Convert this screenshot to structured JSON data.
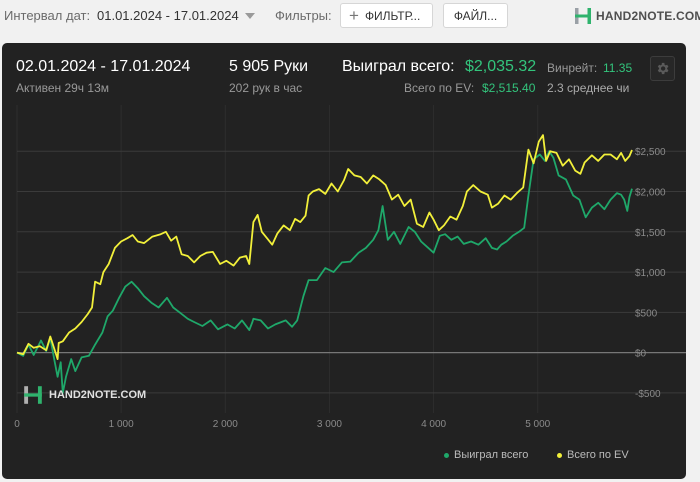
{
  "toolbar": {
    "date_label": "Интервал дат:",
    "date_value": "01.01.2024 - 17.01.2024",
    "filters_label": "Фильтры:",
    "filters_button": "ФИЛЬТР...",
    "files_button": "ФАЙЛ...",
    "logo_text": "HAND2NOTE.COM"
  },
  "stats": {
    "date_range": "02.01.2024 - 17.01.2024",
    "active": "Активен 29ч 13м",
    "hands": "5 905 Руки",
    "hands_per_hour": "202 рук в час",
    "won_total_label": "Выиграл всего:",
    "won_total_value": "$2,035.32",
    "ev_label": "Всего по EV:",
    "ev_value": "$2,515.40",
    "winrate_label": "Винрейт:",
    "winrate_value": "11.35",
    "avg_text": "2.3 среднее чи"
  },
  "watermark": "HAND2NOTE.COM",
  "colors": {
    "won": "#1fa86a",
    "ev": "#f2f03a",
    "background": "#222222",
    "accent": "#33c47c"
  },
  "chart_data": {
    "type": "line",
    "title": "",
    "xlabel": "",
    "ylabel": "",
    "xlim": [
      0,
      5905
    ],
    "ylim": [
      -700,
      2950
    ],
    "x_ticks": [
      0,
      1000,
      2000,
      3000,
      4000,
      5000
    ],
    "x_tick_labels": [
      "0",
      "1 000",
      "2 000",
      "3 000",
      "4 000",
      "5 000"
    ],
    "y_ticks": [
      -500,
      0,
      500,
      1000,
      1500,
      2000,
      2500
    ],
    "y_tick_labels": [
      "-$500",
      "$0",
      "$500",
      "$1,000",
      "$1,500",
      "$2,000",
      "$2,500"
    ],
    "grid": true,
    "legend_position": "bottom-right",
    "series": [
      {
        "name": "Выиграл всего",
        "color": "#1fa86a",
        "points": [
          [
            0,
            0
          ],
          [
            60,
            -40
          ],
          [
            110,
            100
          ],
          [
            160,
            -30
          ],
          [
            230,
            150
          ],
          [
            280,
            20
          ],
          [
            320,
            180
          ],
          [
            360,
            -100
          ],
          [
            390,
            -300
          ],
          [
            420,
            -120
          ],
          [
            440,
            -500
          ],
          [
            470,
            -300
          ],
          [
            520,
            -80
          ],
          [
            560,
            -230
          ],
          [
            620,
            -60
          ],
          [
            690,
            -40
          ],
          [
            750,
            100
          ],
          [
            820,
            250
          ],
          [
            870,
            450
          ],
          [
            920,
            520
          ],
          [
            980,
            680
          ],
          [
            1040,
            820
          ],
          [
            1100,
            880
          ],
          [
            1160,
            800
          ],
          [
            1220,
            700
          ],
          [
            1290,
            620
          ],
          [
            1360,
            560
          ],
          [
            1440,
            680
          ],
          [
            1500,
            560
          ],
          [
            1560,
            500
          ],
          [
            1640,
            420
          ],
          [
            1700,
            380
          ],
          [
            1780,
            330
          ],
          [
            1860,
            400
          ],
          [
            1930,
            290
          ],
          [
            2020,
            350
          ],
          [
            2090,
            300
          ],
          [
            2160,
            400
          ],
          [
            2230,
            280
          ],
          [
            2260,
            380
          ],
          [
            2270,
            420
          ],
          [
            2340,
            400
          ],
          [
            2410,
            300
          ],
          [
            2480,
            350
          ],
          [
            2580,
            400
          ],
          [
            2640,
            320
          ],
          [
            2690,
            400
          ],
          [
            2750,
            700
          ],
          [
            2800,
            900
          ],
          [
            2880,
            900
          ],
          [
            2960,
            1050
          ],
          [
            3040,
            1000
          ],
          [
            3120,
            1120
          ],
          [
            3200,
            1130
          ],
          [
            3280,
            1240
          ],
          [
            3350,
            1300
          ],
          [
            3420,
            1400
          ],
          [
            3470,
            1520
          ],
          [
            3510,
            1820
          ],
          [
            3560,
            1400
          ],
          [
            3620,
            1500
          ],
          [
            3680,
            1350
          ],
          [
            3760,
            1560
          ],
          [
            3820,
            1500
          ],
          [
            3880,
            1380
          ],
          [
            3940,
            1310
          ],
          [
            4000,
            1240
          ],
          [
            4060,
            1450
          ],
          [
            4110,
            1470
          ],
          [
            4170,
            1400
          ],
          [
            4230,
            1440
          ],
          [
            4290,
            1350
          ],
          [
            4360,
            1380
          ],
          [
            4430,
            1340
          ],
          [
            4500,
            1420
          ],
          [
            4560,
            1300
          ],
          [
            4610,
            1280
          ],
          [
            4650,
            1340
          ],
          [
            4700,
            1380
          ],
          [
            4760,
            1450
          ],
          [
            4820,
            1500
          ],
          [
            4870,
            1550
          ],
          [
            4910,
            1950
          ],
          [
            4960,
            2400
          ],
          [
            5020,
            2460
          ],
          [
            5070,
            2380
          ],
          [
            5110,
            2500
          ],
          [
            5150,
            2420
          ],
          [
            5200,
            2200
          ],
          [
            5270,
            2150
          ],
          [
            5340,
            1950
          ],
          [
            5400,
            1900
          ],
          [
            5460,
            1680
          ],
          [
            5520,
            1800
          ],
          [
            5580,
            1860
          ],
          [
            5640,
            1780
          ],
          [
            5700,
            1900
          ],
          [
            5760,
            1980
          ],
          [
            5800,
            1960
          ],
          [
            5830,
            1900
          ],
          [
            5860,
            1760
          ],
          [
            5880,
            1930
          ],
          [
            5905,
            2035.32
          ]
        ]
      },
      {
        "name": "Всего по EV",
        "color": "#f2f03a",
        "points": [
          [
            0,
            0
          ],
          [
            60,
            -20
          ],
          [
            110,
            110
          ],
          [
            160,
            60
          ],
          [
            220,
            80
          ],
          [
            280,
            30
          ],
          [
            320,
            200
          ],
          [
            360,
            40
          ],
          [
            390,
            -80
          ],
          [
            400,
            120
          ],
          [
            440,
            140
          ],
          [
            500,
            250
          ],
          [
            560,
            300
          ],
          [
            620,
            380
          ],
          [
            680,
            480
          ],
          [
            720,
            560
          ],
          [
            750,
            880
          ],
          [
            800,
            850
          ],
          [
            830,
            1000
          ],
          [
            880,
            1100
          ],
          [
            940,
            1300
          ],
          [
            1000,
            1380
          ],
          [
            1060,
            1420
          ],
          [
            1110,
            1460
          ],
          [
            1160,
            1380
          ],
          [
            1220,
            1360
          ],
          [
            1300,
            1440
          ],
          [
            1380,
            1470
          ],
          [
            1430,
            1500
          ],
          [
            1480,
            1390
          ],
          [
            1530,
            1440
          ],
          [
            1580,
            1220
          ],
          [
            1640,
            1200
          ],
          [
            1700,
            1120
          ],
          [
            1760,
            1200
          ],
          [
            1820,
            1240
          ],
          [
            1880,
            1250
          ],
          [
            1950,
            1100
          ],
          [
            2010,
            1140
          ],
          [
            2080,
            1080
          ],
          [
            2140,
            1180
          ],
          [
            2200,
            1200
          ],
          [
            2230,
            1100
          ],
          [
            2270,
            1620
          ],
          [
            2310,
            1710
          ],
          [
            2350,
            1500
          ],
          [
            2400,
            1420
          ],
          [
            2450,
            1340
          ],
          [
            2500,
            1480
          ],
          [
            2560,
            1580
          ],
          [
            2620,
            1520
          ],
          [
            2670,
            1660
          ],
          [
            2720,
            1620
          ],
          [
            2770,
            1700
          ],
          [
            2800,
            1950
          ],
          [
            2840,
            2000
          ],
          [
            2900,
            2030
          ],
          [
            2960,
            1970
          ],
          [
            3020,
            2100
          ],
          [
            3080,
            2000
          ],
          [
            3140,
            2140
          ],
          [
            3180,
            2280
          ],
          [
            3240,
            2200
          ],
          [
            3300,
            2180
          ],
          [
            3360,
            2100
          ],
          [
            3420,
            2200
          ],
          [
            3480,
            2150
          ],
          [
            3540,
            2080
          ],
          [
            3600,
            1900
          ],
          [
            3660,
            1960
          ],
          [
            3720,
            1820
          ],
          [
            3780,
            1900
          ],
          [
            3840,
            1600
          ],
          [
            3900,
            1560
          ],
          [
            3960,
            1740
          ],
          [
            4000,
            1650
          ],
          [
            4050,
            1520
          ],
          [
            4100,
            1580
          ],
          [
            4160,
            1690
          ],
          [
            4220,
            1650
          ],
          [
            4280,
            1820
          ],
          [
            4320,
            2000
          ],
          [
            4380,
            2080
          ],
          [
            4450,
            2000
          ],
          [
            4520,
            1960
          ],
          [
            4560,
            1800
          ],
          [
            4620,
            1850
          ],
          [
            4680,
            1950
          ],
          [
            4740,
            1900
          ],
          [
            4800,
            1980
          ],
          [
            4860,
            2050
          ],
          [
            4910,
            2520
          ],
          [
            4960,
            2350
          ],
          [
            5010,
            2620
          ],
          [
            5050,
            2700
          ],
          [
            5080,
            2380
          ],
          [
            5120,
            2500
          ],
          [
            5180,
            2480
          ],
          [
            5240,
            2320
          ],
          [
            5300,
            2400
          ],
          [
            5360,
            2260
          ],
          [
            5410,
            2220
          ],
          [
            5450,
            2360
          ],
          [
            5520,
            2450
          ],
          [
            5580,
            2380
          ],
          [
            5640,
            2460
          ],
          [
            5700,
            2460
          ],
          [
            5760,
            2400
          ],
          [
            5800,
            2480
          ],
          [
            5840,
            2380
          ],
          [
            5880,
            2440
          ],
          [
            5905,
            2515.4
          ]
        ]
      }
    ]
  }
}
